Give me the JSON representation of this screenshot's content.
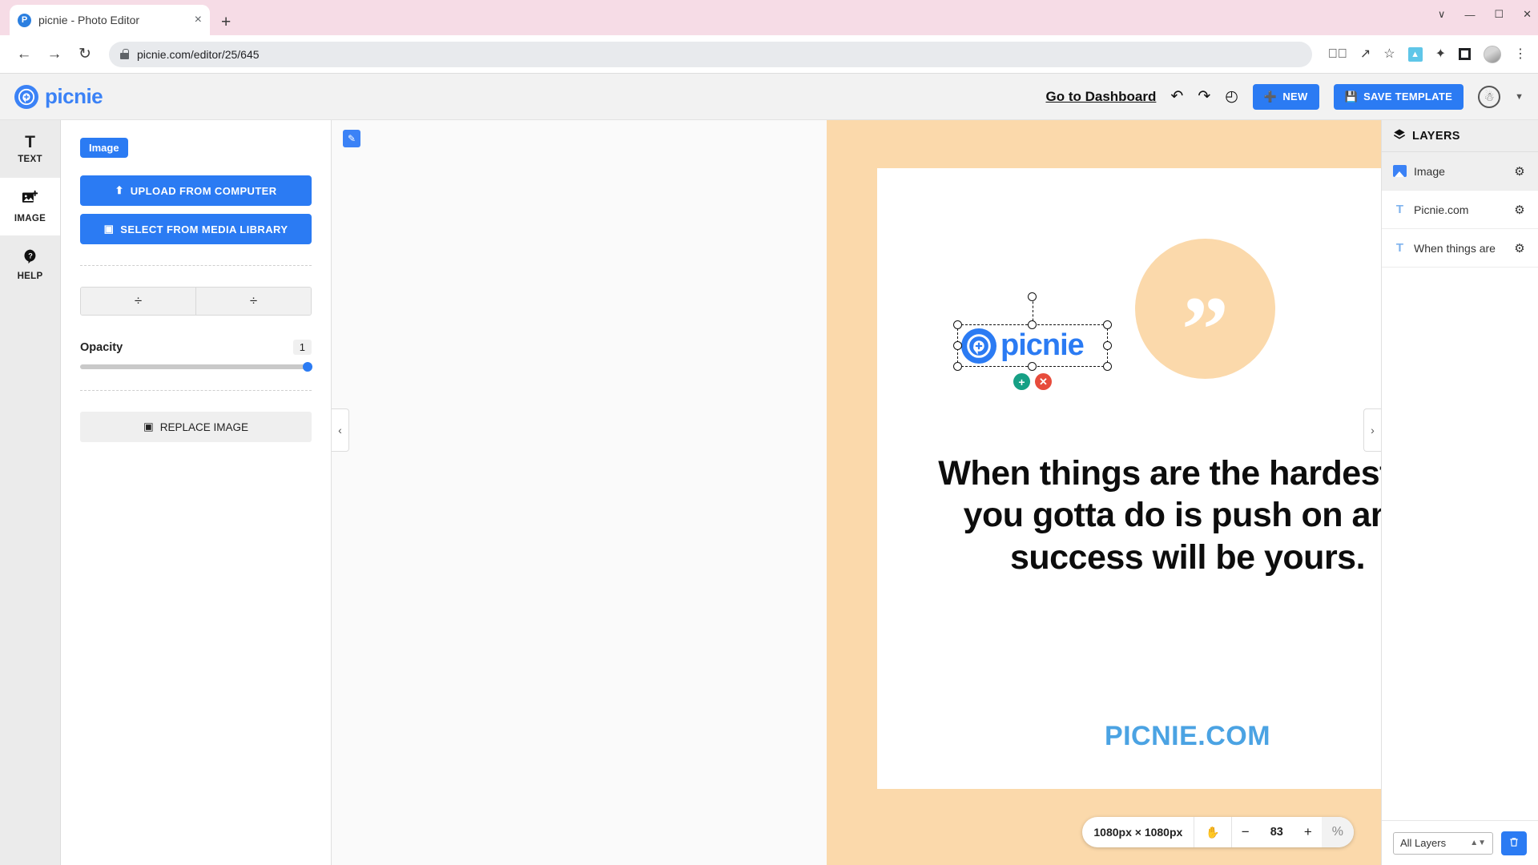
{
  "browser": {
    "tab": {
      "title": "picnie - Photo Editor",
      "favicon": "picnie-favicon",
      "close": "×"
    },
    "new_tab": "+",
    "window_controls": {
      "minimize": "—",
      "maximize": "☐",
      "close": "✕",
      "chevron": "∨"
    },
    "nav": {
      "back": "←",
      "forward": "→",
      "reload": "↻"
    },
    "url": "picnie.com/editor/25/645",
    "toolbar_icons": [
      "eye-slash-icon",
      "share-icon",
      "star-icon",
      "print-extension-icon",
      "puzzle-extension-icon",
      "square-extension-icon",
      "profile-avatar",
      "kebab-menu-icon"
    ]
  },
  "app_header": {
    "brand": "picnie",
    "dashboard_link": "Go to Dashboard",
    "undo": "↶",
    "redo": "↷",
    "history": "◴",
    "new_label": "NEW",
    "save_label": "SAVE TEMPLATE",
    "accent": "#2b7bf3"
  },
  "tool_rail": {
    "items": [
      {
        "label": "TEXT",
        "glyph": "T",
        "icon": "text-tool-icon",
        "active": false
      },
      {
        "label": "IMAGE",
        "glyph": "⛰",
        "icon": "image-tool-icon",
        "active": true
      },
      {
        "label": "HELP",
        "glyph": "?",
        "icon": "help-tool-icon",
        "active": false
      }
    ]
  },
  "left_panel": {
    "chip": "Image",
    "upload_label": "UPLOAD FROM COMPUTER",
    "upload_icon": "⬆",
    "library_label": "SELECT FROM MEDIA LIBRARY",
    "library_icon": "▣",
    "align_buttons": [
      {
        "name": "align-vertical",
        "glyph": "÷"
      },
      {
        "name": "align-horizontal",
        "glyph": "÷"
      }
    ],
    "opacity_label": "Opacity",
    "opacity_value": "1",
    "replace_label": "REPLACE IMAGE",
    "replace_icon": "▣"
  },
  "canvas": {
    "artboard_bg": "#fbd9ab",
    "page_bg": "#ffffff",
    "quote_glyph": "”",
    "quote_text": "When things are the hardest all you gotta do is push on and success will be yours.",
    "footer_text": "PICNIE.COM",
    "footer_color": "#4ba3e3",
    "selected_object": {
      "type": "image",
      "label": "picnie",
      "add_action": "+",
      "delete_action": "✕"
    },
    "collapse_left": "‹",
    "collapse_right": "›"
  },
  "zoom_bar": {
    "dimensions": "1080px × 1080px",
    "hand_icon": "✋",
    "minus": "−",
    "value": "83",
    "plus": "+",
    "percent": "%"
  },
  "layers": {
    "title": "LAYERS",
    "title_icon": "layers-icon",
    "rows": [
      {
        "name": "Image",
        "type": "image",
        "selected": true
      },
      {
        "name": "Picnie.com",
        "type": "text",
        "selected": false
      },
      {
        "name": "When things are th",
        "type": "text",
        "selected": false
      }
    ],
    "filter_value": "All Layers",
    "delete_icon": "🗑"
  }
}
